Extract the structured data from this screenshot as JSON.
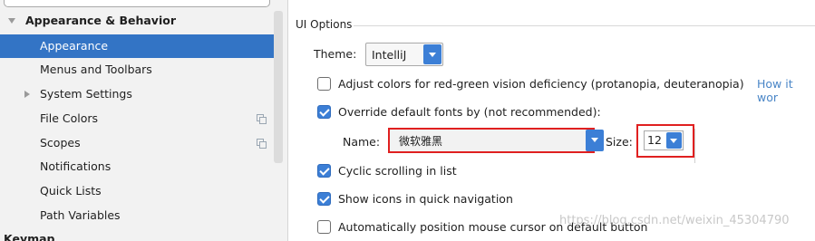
{
  "sidebar": {
    "items": [
      {
        "label": "Appearance & Behavior"
      },
      {
        "label": "Appearance"
      },
      {
        "label": "Menus and Toolbars"
      },
      {
        "label": "System Settings"
      },
      {
        "label": "File Colors"
      },
      {
        "label": "Scopes"
      },
      {
        "label": "Notifications"
      },
      {
        "label": "Quick Lists"
      },
      {
        "label": "Path Variables"
      },
      {
        "label": "Keymap"
      }
    ]
  },
  "ui_options": {
    "section_title": "UI Options",
    "theme": {
      "label": "Theme:",
      "value": "IntelliJ"
    },
    "adjust_colors": {
      "label": "Adjust colors for red-green vision deficiency (protanopia, deuteranopia)",
      "checked": false,
      "link": "How it wor"
    },
    "override_fonts": {
      "label": "Override default fonts by (not recommended):",
      "checked": true
    },
    "font_name": {
      "label": "Name:",
      "value": "微软雅黑"
    },
    "font_size": {
      "label": "Size:",
      "value": "12"
    },
    "cyclic_scrolling": {
      "label": "Cyclic scrolling in list",
      "checked": true
    },
    "show_icons": {
      "label": "Show icons in quick navigation",
      "checked": true
    },
    "auto_position": {
      "label": "Automatically position mouse cursor on default button",
      "checked": false
    }
  },
  "watermark": "https://blog.csdn.net/weixin_45304790",
  "colors": {
    "selection": "#3374c5",
    "accent": "#3c7fd6",
    "highlight_box": "#e02020",
    "link": "#4a86c7"
  }
}
